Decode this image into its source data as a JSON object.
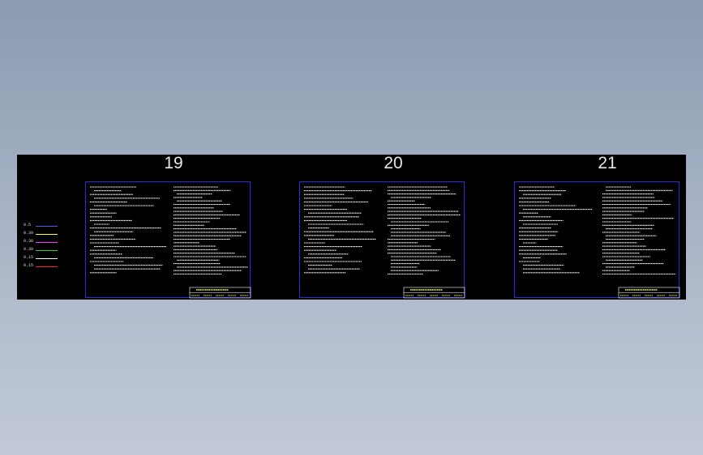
{
  "sheets": [
    {
      "number": "19"
    },
    {
      "number": "20"
    },
    {
      "number": "21"
    }
  ],
  "legend": [
    {
      "label": "0.5",
      "color": "#3a5cff"
    },
    {
      "label": "0.30",
      "color": "#ffff33"
    },
    {
      "label": "0.30",
      "color": "#ff33ff"
    },
    {
      "label": "0.30",
      "color": "#33cc33"
    },
    {
      "label": "0.15",
      "color": "#ffffff"
    },
    {
      "label": "0.15",
      "color": "#ff2222"
    }
  ],
  "colors": {
    "background_top": "#8a9bb0",
    "background_bottom": "#c2cad7",
    "viewport": "#000000",
    "sheet_border": "#2a2adf",
    "text_lines": "#ffffff",
    "title_block": "#ffff33"
  }
}
